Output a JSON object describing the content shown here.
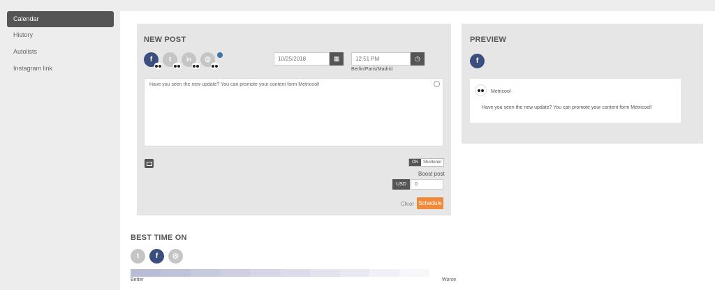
{
  "sidebar": {
    "items": [
      {
        "label": "Calendar",
        "active": true
      },
      {
        "label": "History"
      },
      {
        "label": "Autolists"
      },
      {
        "label": "Instagram link"
      }
    ]
  },
  "newpost": {
    "title": "NEW POST",
    "networks": [
      {
        "name": "facebook",
        "glyph": "f",
        "selected": true
      },
      {
        "name": "twitter",
        "glyph": "t",
        "selected": false
      },
      {
        "name": "linkedin",
        "glyph": "in",
        "selected": false
      },
      {
        "name": "instagram",
        "glyph": "◎",
        "selected": false
      }
    ],
    "date": "10/25/2018",
    "time": "12:51 PM",
    "timezone": "Berlin/Paris/Madrid",
    "message": "Have you seen the new update? You can promote your content form Metricool!",
    "shortener_on": "ON",
    "shortener_label": "Shortener",
    "boost_label": "Boost post",
    "currency": "USD",
    "boost_value": "0",
    "clear": "Clear",
    "schedule": "Schedule"
  },
  "preview": {
    "title": "PREVIEW",
    "network_glyph": "f",
    "account": "Metricool",
    "message": "Have you seen the new update? You can promote your content form Metricool!"
  },
  "best_time": {
    "title": "BEST TIME ON",
    "networks": [
      {
        "name": "twitter",
        "glyph": "t",
        "selected": false
      },
      {
        "name": "facebook",
        "glyph": "f",
        "selected": true
      },
      {
        "name": "instagram",
        "glyph": "◎",
        "selected": false
      }
    ],
    "better": "Better",
    "worse": "Worse"
  },
  "colors": {
    "facebook": "#3b4f7f",
    "schedule": "#f08a3a",
    "dark": "#555555"
  }
}
